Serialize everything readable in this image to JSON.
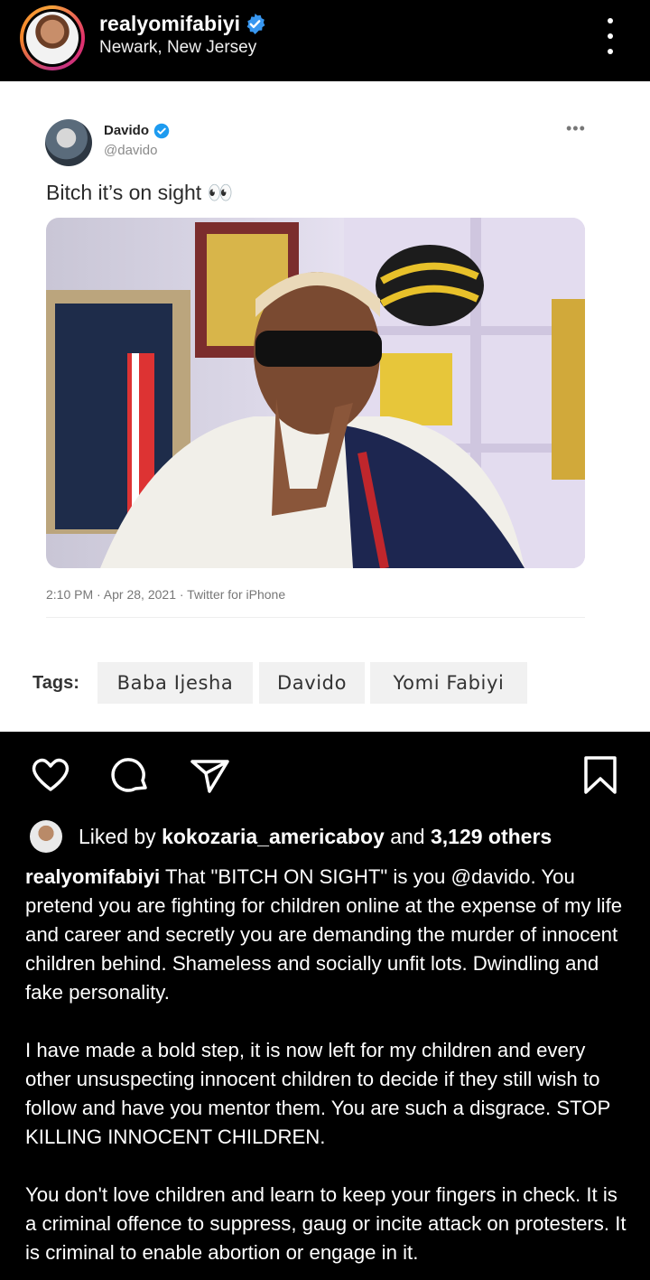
{
  "header": {
    "username": "realyomifabiyi",
    "location": "Newark, New Jersey",
    "verified_icon": "verified-badge-icon",
    "more_icon": "more-vertical-icon"
  },
  "tweet": {
    "name": "Davido",
    "handle": "@davido",
    "more": "•••",
    "text": "Bitch it’s on sight 👀",
    "timestamp": "2:10 PM · Apr 28, 2021 · Twitter for iPhone"
  },
  "tags": {
    "label": "Tags:",
    "items": [
      "Baba Ijesha",
      "Davido",
      "Yomi Fabiyi"
    ]
  },
  "actions": {
    "like_icon": "heart-icon",
    "comment_icon": "comment-icon",
    "share_icon": "send-icon",
    "save_icon": "bookmark-icon"
  },
  "likes": {
    "prefix": "Liked by",
    "user": "kokozaria_americaboy",
    "and": "and",
    "others": "3,129 others"
  },
  "caption": {
    "user": "realyomifabiyi",
    "p1": "That \"BITCH ON SIGHT\" is you @davido. You pretend you are fighting for children online at the expense of my life and career and secretly you are demanding the murder of innocent children behind. Shameless and socially unfit lots. Dwindling and fake personality.",
    "p2": "I have made a bold step, it is now left for my children and every other unsuspecting innocent children to decide if they still wish to follow and have you mentor them. You are such a disgrace. STOP KILLING INNOCENT CHILDREN.",
    "p3": "You don't love children and learn to keep your fingers in check. It is a criminal offence to suppress, gaug or incite attack on protesters. It is criminal to enable abortion or engage in it."
  },
  "colors": {
    "background": "#000000",
    "verified": "#3897f0",
    "post_bg": "#ffffff"
  }
}
